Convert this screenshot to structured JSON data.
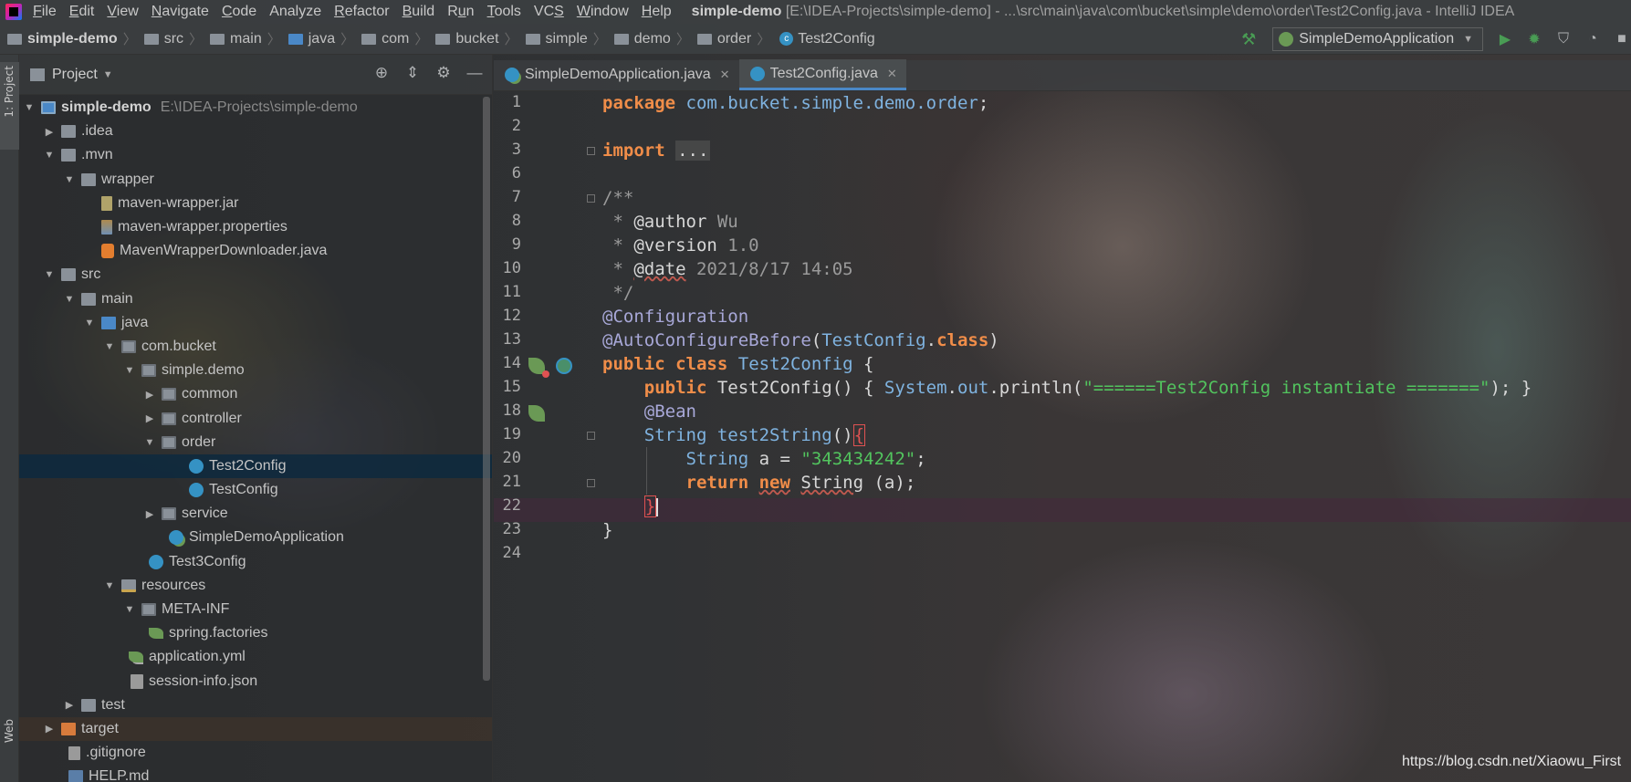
{
  "menubar": {
    "items": [
      "File",
      "Edit",
      "View",
      "Navigate",
      "Code",
      "Analyze",
      "Refactor",
      "Build",
      "Run",
      "Tools",
      "VCS",
      "Window",
      "Help"
    ],
    "title_project": "simple-demo",
    "title_rest": "[E:\\IDEA-Projects\\simple-demo] - ...\\src\\main\\java\\com\\bucket\\simple\\demo\\order\\Test2Config.java - IntelliJ IDEA"
  },
  "navbar": {
    "crumbs": [
      "simple-demo",
      "src",
      "main",
      "java",
      "com",
      "bucket",
      "simple",
      "demo",
      "order",
      "Test2Config"
    ],
    "run_config": "SimpleDemoApplication"
  },
  "stripe": {
    "project_tab": "1: Project",
    "web_tab": "Web"
  },
  "project_panel": {
    "title": "Project",
    "tree": [
      {
        "label": "simple-demo",
        "hint": "E:\\IDEA-Projects\\simple-demo"
      },
      {
        "label": ".idea"
      },
      {
        "label": ".mvn"
      },
      {
        "label": "wrapper"
      },
      {
        "label": "maven-wrapper.jar"
      },
      {
        "label": "maven-wrapper.properties"
      },
      {
        "label": "MavenWrapperDownloader.java"
      },
      {
        "label": "src"
      },
      {
        "label": "main"
      },
      {
        "label": "java"
      },
      {
        "label": "com.bucket"
      },
      {
        "label": "simple.demo"
      },
      {
        "label": "common"
      },
      {
        "label": "controller"
      },
      {
        "label": "order"
      },
      {
        "label": "Test2Config"
      },
      {
        "label": "TestConfig"
      },
      {
        "label": "service"
      },
      {
        "label": "SimpleDemoApplication"
      },
      {
        "label": "Test3Config"
      },
      {
        "label": "resources"
      },
      {
        "label": "META-INF"
      },
      {
        "label": "spring.factories"
      },
      {
        "label": "application.yml"
      },
      {
        "label": "session-info.json"
      },
      {
        "label": "test"
      },
      {
        "label": "target"
      },
      {
        "label": ".gitignore"
      },
      {
        "label": "HELP.md"
      }
    ]
  },
  "editor": {
    "tabs": [
      {
        "label": "SimpleDemoApplication.java",
        "active": false
      },
      {
        "label": "Test2Config.java",
        "active": true
      }
    ],
    "line_numbers": [
      "1",
      "2",
      "3",
      "6",
      "7",
      "8",
      "9",
      "10",
      "11",
      "12",
      "13",
      "14",
      "15",
      "18",
      "19",
      "20",
      "21",
      "22",
      "23",
      "24"
    ],
    "code": {
      "package_kw": "package",
      "package_name": "com.bucket.simple.demo.order",
      "import_kw": "import",
      "import_fold": "...",
      "doc_open": "/**",
      "author_tag": "@author",
      "author_val": "Wu",
      "version_tag": "@version",
      "version_val": "1.0",
      "date_tag": "@date",
      "date_val": "2021/8/17 14:05",
      "doc_close": "*/",
      "ann_configuration": "@Configuration",
      "ann_autoconfig": "@AutoConfigureBefore",
      "autoconfig_arg": "TestConfig",
      "class_kw": "class",
      "public_kw": "public",
      "class_name": "Test2Config",
      "ctor_name": "Test2Config",
      "system": "System",
      "out": "out",
      "println": "println",
      "message": "\"======Test2Config instantiate =======\"",
      "ann_bean": "@Bean",
      "string_type": "String",
      "method_name": "test2String",
      "var_a": "a",
      "str_value": "\"343434242\"",
      "return_kw": "return",
      "new_kw": "new"
    }
  },
  "watermark": "https://blog.csdn.net/Xiaowu_First"
}
